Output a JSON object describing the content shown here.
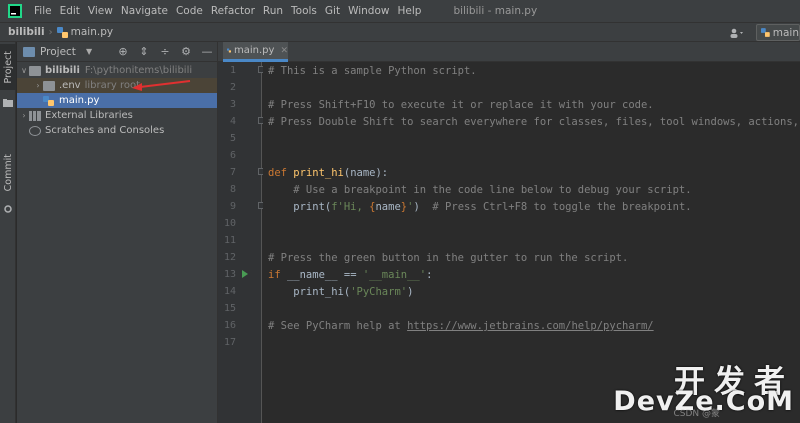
{
  "window": {
    "title": "bilibili - main.py",
    "menu": [
      "File",
      "Edit",
      "View",
      "Navigate",
      "Code",
      "Refactor",
      "Run",
      "Tools",
      "Git",
      "Window",
      "Help"
    ]
  },
  "navbar": {
    "project": "bilibili",
    "file": "main.py",
    "run_config": "main",
    "user_icon": "user-icon"
  },
  "toolstrip": {
    "project_label": "Project",
    "commit_label": "Commit"
  },
  "project_panel": {
    "title": "Project",
    "tree": [
      {
        "label": "bilibili",
        "hint": "F:\\pythonitems\\bilibili",
        "type": "root"
      },
      {
        "label": ".env",
        "hint": "library root",
        "type": "excluded"
      },
      {
        "label": "main.py",
        "type": "file"
      },
      {
        "label": "External Libraries",
        "type": "lib"
      },
      {
        "label": "Scratches and Consoles",
        "type": "scratch"
      }
    ]
  },
  "editor": {
    "tab": "main.py",
    "line_numbers": [
      "1",
      "2",
      "3",
      "4",
      "5",
      "6",
      "7",
      "8",
      "9",
      "10",
      "11",
      "12",
      "13",
      "14",
      "15",
      "16",
      "17"
    ],
    "lines": {
      "l1": "# This is a sample Python script.",
      "l3": "# Press Shift+F10 to execute it or replace it with your code.",
      "l4": "# Press Double Shift to search everywhere for classes, files, tool windows, actions, and se",
      "l7_kw": "def ",
      "l7_fn": "print_hi",
      "l7_rest": "(name):",
      "l8": "    # Use a breakpoint in the code line below to debug your script.",
      "l9_a": "    print(",
      "l9_str1": "f'Hi, ",
      "l9_brace_o": "{",
      "l9_var": "name",
      "l9_brace_c": "}",
      "l9_str2": "'",
      "l9_b": ")  ",
      "l9_com": "# Press Ctrl+F8 to toggle the breakpoint.",
      "l12": "# Press the green button in the gutter to run the script.",
      "l13_kw": "if ",
      "l13_d1": "__name__",
      "l13_op": " == ",
      "l13_str": "'__main__'",
      "l13_end": ":",
      "l14_a": "    print_hi(",
      "l14_str": "'PyCharm'",
      "l14_b": ")",
      "l16_com": "# See PyCharm help at ",
      "l16_link": "https://www.jetbrains.com/help/pycharm/"
    }
  },
  "watermark": {
    "main": "开发者",
    "sub": "DevZe.CoM",
    "small": "CSDN @蒙"
  },
  "colors": {
    "accent": "#4a88c7",
    "selection": "#4a6fa8",
    "annotation": "#e03030",
    "run": "#499c54"
  }
}
